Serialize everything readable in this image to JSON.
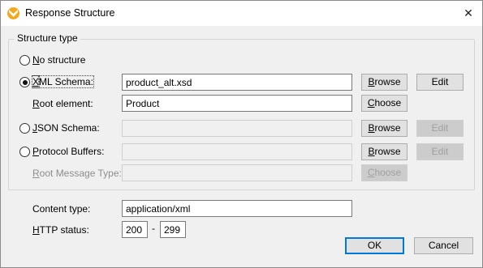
{
  "window": {
    "title": "Response Structure",
    "close_glyph": "✕",
    "app_icon": "mapforce-logo-icon"
  },
  "structure": {
    "group_label": "Structure type",
    "no_structure": {
      "mnemonic": "N",
      "rest": "o structure",
      "selected": false
    },
    "xml_schema": {
      "mnemonic": "X",
      "rest": "ML Schema:",
      "selected": true,
      "value": "product_alt.xsd",
      "browse_mnemonic": "B",
      "browse_rest": "rowse",
      "edit_label": "Edit"
    },
    "root_element": {
      "mnemonic": "R",
      "rest": "oot element:",
      "value": "Product",
      "choose_mnemonic": "C",
      "choose_rest": "hoose"
    },
    "json_schema": {
      "mnemonic": "J",
      "rest": "SON Schema:",
      "selected": false,
      "value": "",
      "browse_mnemonic": "B",
      "browse_rest": "rowse",
      "edit_label": "Edit"
    },
    "protocol_buffers": {
      "mnemonic": "P",
      "rest": "rotocol Buffers:",
      "selected": false,
      "value": "",
      "browse_mnemonic": "B",
      "browse_rest": "rowse",
      "edit_label": "Edit"
    },
    "root_message_type": {
      "mnemonic": "R",
      "rest": "oot Message Type:",
      "value": "",
      "choose_mnemonic": "C",
      "choose_rest": "hoose"
    }
  },
  "content_type": {
    "label": "Content type:",
    "value": "application/xml"
  },
  "http_status": {
    "mnemonic": "H",
    "rest": "TTP status:",
    "from": "200",
    "separator": "-",
    "to": "299"
  },
  "buttons": {
    "ok": "OK",
    "cancel": "Cancel"
  }
}
